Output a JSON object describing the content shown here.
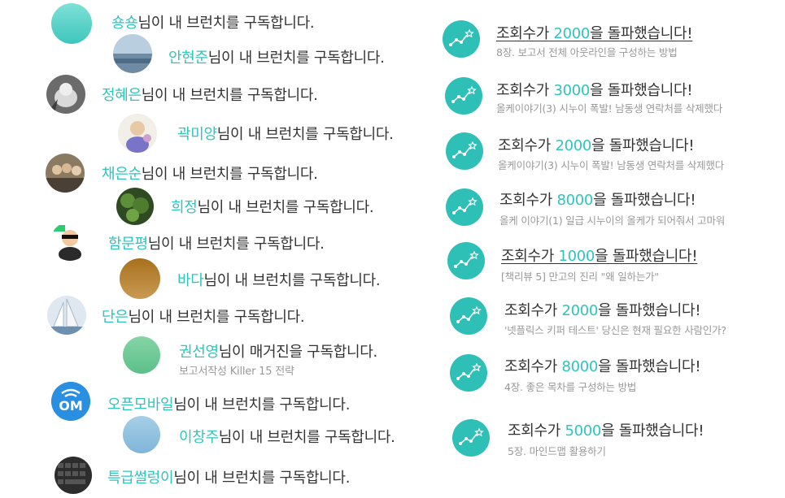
{
  "subscribe_suffix": "님이 내 브런치를 구독합니다.",
  "magazine_suffix": "님이 매거진을 구독합니다.",
  "subscriptions": [
    {
      "name": "숑숑",
      "avatar": "teal-avatar"
    },
    {
      "name": "안현준",
      "avatar": "landscape-avatar"
    },
    {
      "name": "정혜은",
      "avatar": "cat-avatar"
    },
    {
      "name": "곽미양",
      "avatar": "illustration-avatar"
    },
    {
      "name": "채은순",
      "avatar": "group-photo-avatar"
    },
    {
      "name": "희정",
      "avatar": "plant-avatar"
    },
    {
      "name": "함문평",
      "avatar": "cartoon-avatar"
    },
    {
      "name": "바다",
      "avatar": "brown-avatar"
    },
    {
      "name": "단은",
      "avatar": "sailboat-avatar"
    },
    {
      "name": "권선영",
      "avatar": "green-avatar",
      "magazine": "보고서작성 Killer 15 전략"
    },
    {
      "name": "오픈모바일",
      "avatar": "om-logo-avatar",
      "logo_text": "OM"
    },
    {
      "name": "이창주",
      "avatar": "blue-avatar"
    },
    {
      "name": "특급썰렁이",
      "avatar": "keyboard-avatar"
    }
  ],
  "milestone": {
    "prefix": "조회수가 ",
    "suffix": "을 돌파했습니다!"
  },
  "view_milestones": [
    {
      "count": "2000",
      "article": "8장. 보고서 전체 아웃라인을 구성하는 방법"
    },
    {
      "count": "3000",
      "article": "올케이야기(3) 시누이 폭발! 남동생 연락처를 삭제했다"
    },
    {
      "count": "2000",
      "article": "올케이야기(3) 시누이 폭발! 남동생 연락처를 삭제했다"
    },
    {
      "count": "8000",
      "article": "올케 이야기(1) 일급 시누이의 올케가 되어줘서 고마워"
    },
    {
      "count": "1000",
      "article": "[책리뷰 5] 만고의 진리 \"왜 일하는가\""
    },
    {
      "count": "2000",
      "article": "'넷플릭스 키퍼 테스트' 당신은 현재 필요한 사람인가?"
    },
    {
      "count": "8000",
      "article": "4장. 좋은 목차를 구성하는 방법"
    },
    {
      "count": "5000",
      "article": "5장. 마인드맵 활용하기"
    }
  ],
  "colors": {
    "accent": "#2fc4bc",
    "icon_bg": "#2ebfb7",
    "text": "#333333",
    "subtext": "#999999"
  }
}
